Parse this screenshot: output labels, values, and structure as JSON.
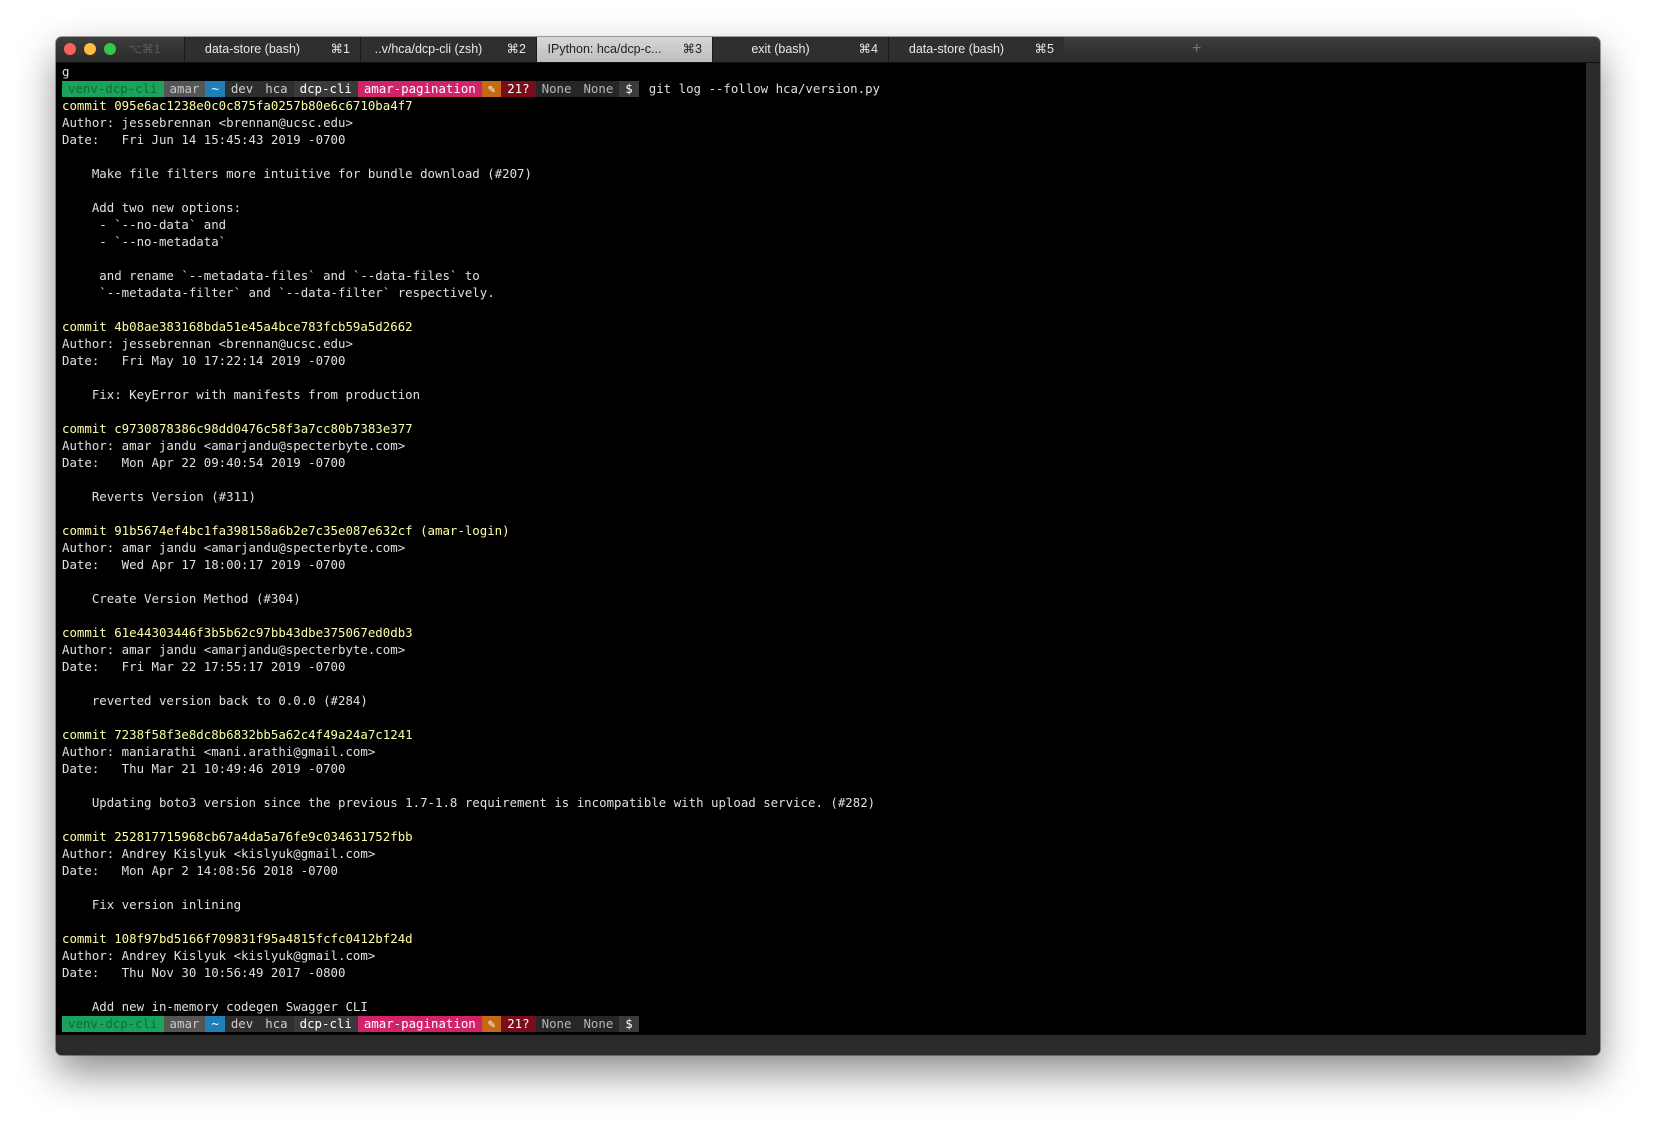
{
  "window": {
    "shortcut": "⌥⌘1",
    "tabs": [
      {
        "label": "data-store (bash)",
        "key": "⌘1",
        "active": false
      },
      {
        "label": "..v/hca/dcp-cli (zsh)",
        "key": "⌘2",
        "active": false
      },
      {
        "label": "IPython: hca/dcp-c...",
        "key": "⌘3",
        "active": true
      },
      {
        "label": "exit (bash)",
        "key": "⌘4",
        "active": false
      },
      {
        "label": "data-store (bash)",
        "key": "⌘5",
        "active": false
      }
    ],
    "new_tab_label": "+"
  },
  "prompt": {
    "segments": [
      {
        "text": "venv-dcp-cli",
        "bg": "#1aa35b",
        "fg": "#0d6b3a"
      },
      {
        "text": "amar",
        "bg": "#555555",
        "fg": "#c8c8c8"
      },
      {
        "text": "~",
        "bg": "#1f7fb8",
        "fg": "#ffffff"
      },
      {
        "text": "dev",
        "bg": "#2e2e2e",
        "fg": "#cfcfcf"
      },
      {
        "text": "hca",
        "bg": "#2e2e2e",
        "fg": "#cfcfcf"
      },
      {
        "text": "dcp-cli",
        "bg": "#3a3a3a",
        "fg": "#ffffff"
      },
      {
        "text": "amar-pagination",
        "bg": "#d1236a",
        "fg": "#ffffff"
      },
      {
        "text": "✎",
        "bg": "#c46a14",
        "fg": "#ffffff"
      },
      {
        "text": "21?",
        "bg": "#7a0d1a",
        "fg": "#ffffff"
      },
      {
        "text": "None",
        "bg": "#262626",
        "fg": "#b5b5b5"
      },
      {
        "text": "None",
        "bg": "#262626",
        "fg": "#b5b5b5"
      },
      {
        "text": "$",
        "bg": "#3a3a3a",
        "fg": "#ffffff"
      }
    ],
    "command": "git log --follow hca/version.py"
  },
  "buffer": {
    "first_line": "g",
    "log": [
      {
        "kind": "commit",
        "text": "commit 095e6ac1238e0c0c875fa0257b80e6c6710ba4f7"
      },
      {
        "kind": "text",
        "text": "Author: jessebrennan <brennan@ucsc.edu>"
      },
      {
        "kind": "text",
        "text": "Date:   Fri Jun 14 15:45:43 2019 -0700"
      },
      {
        "kind": "text",
        "text": ""
      },
      {
        "kind": "text",
        "text": "    Make file filters more intuitive for bundle download (#207)"
      },
      {
        "kind": "text",
        "text": ""
      },
      {
        "kind": "text",
        "text": "    Add two new options:"
      },
      {
        "kind": "text",
        "text": "     - `--no-data` and"
      },
      {
        "kind": "text",
        "text": "     - `--no-metadata`"
      },
      {
        "kind": "text",
        "text": ""
      },
      {
        "kind": "text",
        "text": "     and rename `--metadata-files` and `--data-files` to"
      },
      {
        "kind": "text",
        "text": "     `--metadata-filter` and `--data-filter` respectively."
      },
      {
        "kind": "text",
        "text": ""
      },
      {
        "kind": "commit",
        "text": "commit 4b08ae383168bda51e45a4bce783fcb59a5d2662"
      },
      {
        "kind": "text",
        "text": "Author: jessebrennan <brennan@ucsc.edu>"
      },
      {
        "kind": "text",
        "text": "Date:   Fri May 10 17:22:14 2019 -0700"
      },
      {
        "kind": "text",
        "text": ""
      },
      {
        "kind": "text",
        "text": "    Fix: KeyError with manifests from production"
      },
      {
        "kind": "text",
        "text": ""
      },
      {
        "kind": "commit",
        "text": "commit c9730878386c98dd0476c58f3a7cc80b7383e377"
      },
      {
        "kind": "text",
        "text": "Author: amar jandu <amarjandu@specterbyte.com>"
      },
      {
        "kind": "text",
        "text": "Date:   Mon Apr 22 09:40:54 2019 -0700"
      },
      {
        "kind": "text",
        "text": ""
      },
      {
        "kind": "text",
        "text": "    Reverts Version (#311)"
      },
      {
        "kind": "text",
        "text": ""
      },
      {
        "kind": "commit",
        "text": "commit 91b5674ef4bc1fa398158a6b2e7c35e087e632cf (amar-login)"
      },
      {
        "kind": "text",
        "text": "Author: amar jandu <amarjandu@specterbyte.com>"
      },
      {
        "kind": "text",
        "text": "Date:   Wed Apr 17 18:00:17 2019 -0700"
      },
      {
        "kind": "text",
        "text": ""
      },
      {
        "kind": "text",
        "text": "    Create Version Method (#304)"
      },
      {
        "kind": "text",
        "text": ""
      },
      {
        "kind": "commit",
        "text": "commit 61e44303446f3b5b62c97bb43dbe375067ed0db3"
      },
      {
        "kind": "text",
        "text": "Author: amar jandu <amarjandu@specterbyte.com>"
      },
      {
        "kind": "text",
        "text": "Date:   Fri Mar 22 17:55:17 2019 -0700"
      },
      {
        "kind": "text",
        "text": ""
      },
      {
        "kind": "text",
        "text": "    reverted version back to 0.0.0 (#284)"
      },
      {
        "kind": "text",
        "text": ""
      },
      {
        "kind": "commit",
        "text": "commit 7238f58f3e8dc8b6832bb5a62c4f49a24a7c1241"
      },
      {
        "kind": "text",
        "text": "Author: maniarathi <mani.arathi@gmail.com>"
      },
      {
        "kind": "text",
        "text": "Date:   Thu Mar 21 10:49:46 2019 -0700"
      },
      {
        "kind": "text",
        "text": ""
      },
      {
        "kind": "text",
        "text": "    Updating boto3 version since the previous 1.7-1.8 requirement is incompatible with upload service. (#282)"
      },
      {
        "kind": "text",
        "text": ""
      },
      {
        "kind": "commit",
        "text": "commit 252817715968cb67a4da5a76fe9c034631752fbb"
      },
      {
        "kind": "text",
        "text": "Author: Andrey Kislyuk <kislyuk@gmail.com>"
      },
      {
        "kind": "text",
        "text": "Date:   Mon Apr 2 14:08:56 2018 -0700"
      },
      {
        "kind": "text",
        "text": ""
      },
      {
        "kind": "text",
        "text": "    Fix version inlining"
      },
      {
        "kind": "text",
        "text": ""
      },
      {
        "kind": "commit",
        "text": "commit 108f97bd5166f709831f95a4815fcfc0412bf24d"
      },
      {
        "kind": "text",
        "text": "Author: Andrey Kislyuk <kislyuk@gmail.com>"
      },
      {
        "kind": "text",
        "text": "Date:   Thu Nov 30 10:56:49 2017 -0800"
      },
      {
        "kind": "text",
        "text": ""
      },
      {
        "kind": "text",
        "text": "    Add new in-memory codegen Swagger CLI"
      }
    ]
  }
}
